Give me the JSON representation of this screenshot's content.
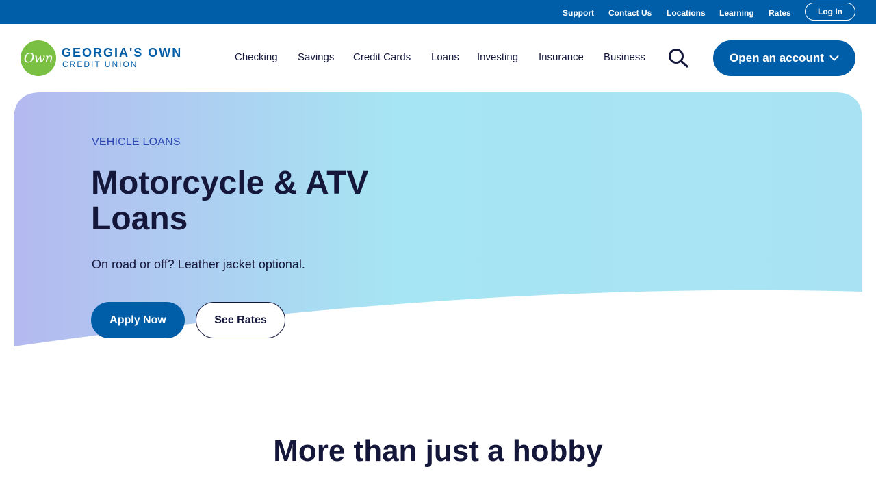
{
  "utility_nav": {
    "support": "Support",
    "contact": "Contact Us",
    "locations": "Locations",
    "learning": "Learning",
    "rates": "Rates",
    "login": "Log In"
  },
  "logo": {
    "mark": "Own",
    "line1": "GEORGIA'S OWN",
    "line2": "CREDIT UNION"
  },
  "main_nav": {
    "items": [
      "Checking",
      "Savings",
      "Credit Cards",
      "Loans",
      "Investing",
      "Insurance",
      "Business"
    ],
    "open_account": "Open an account"
  },
  "hero": {
    "eyebrow": "VEHICLE LOANS",
    "title": "Motorcycle & ATV Loans",
    "subtitle": "On road or off? Leather jacket optional.",
    "apply": "Apply Now",
    "see_rates": "See Rates"
  },
  "section": {
    "title": "More than just a hobby"
  },
  "colors": {
    "brand_blue": "#005ea8",
    "logo_green": "#7ac143",
    "text_dark": "#14163a",
    "hero_gradient_start": "#b4b9ef",
    "hero_gradient_end": "#a6e5f3"
  }
}
